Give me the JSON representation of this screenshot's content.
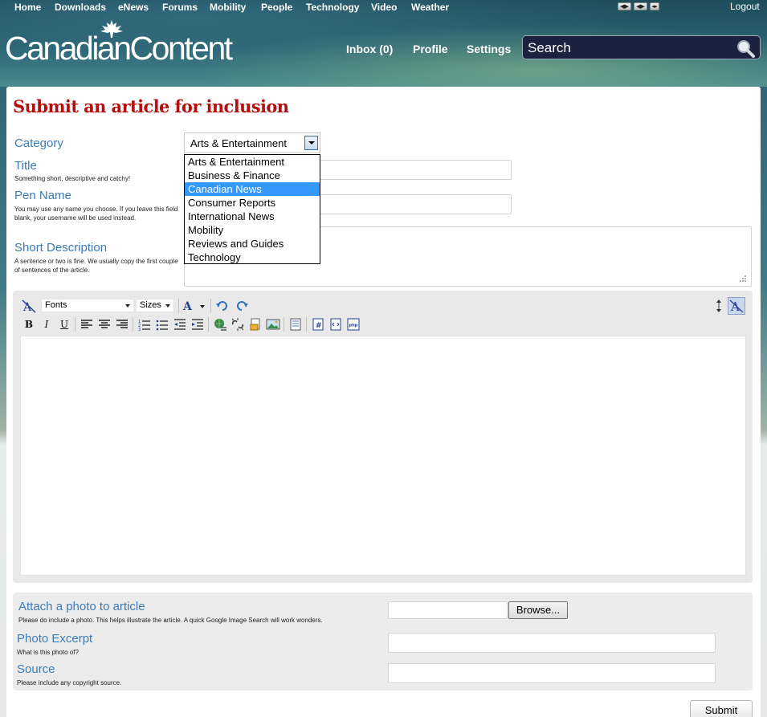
{
  "topnav": {
    "items": [
      "Home",
      "Downloads",
      "eNews",
      "Forums",
      "Mobility",
      "People",
      "Technology",
      "Video",
      "Weather"
    ],
    "logout": "Logout"
  },
  "logo": {
    "text": "CanadianContent"
  },
  "mainnav": {
    "inbox": "Inbox (0)",
    "profile": "Profile",
    "settings": "Settings"
  },
  "search": {
    "placeholder": "Search"
  },
  "page": {
    "title": "Submit an article for inclusion"
  },
  "form": {
    "category": {
      "label": "Category",
      "selected": "Arts & Entertainment",
      "options": [
        "Arts & Entertainment",
        "Business & Finance",
        "Canadian News",
        "Consumer Reports",
        "International News",
        "Mobility",
        "Reviews and Guides",
        "Technology"
      ],
      "highlighted": "Canadian News"
    },
    "title": {
      "label": "Title",
      "help": "Something short, descriptive and catchy!"
    },
    "pen_name": {
      "label": "Pen Name",
      "help": "You may use any name you choose. If you leave this field blank, your username will be used instead."
    },
    "short_description": {
      "label": "Short Description",
      "help": "A sentence or two is fine. We usually copy the first couple of sentences of the article."
    }
  },
  "editor": {
    "fonts_label": "Fonts",
    "sizes_label": "Sizes",
    "bold": "B",
    "italic": "I",
    "underline": "U"
  },
  "attach": {
    "photo": {
      "label": "Attach a photo to article",
      "help": "Please do include a photo. This helps illustrate the article. A quick Google Image Search will work wonders.",
      "browse": "Browse..."
    },
    "excerpt": {
      "label": "Photo Excerpt",
      "help": "What is this photo of?"
    },
    "source": {
      "label": "Source",
      "help": "Please include any copyright source."
    }
  },
  "submit": "Submit",
  "colors": {
    "title_red": "#b50e0e",
    "label_blue": "#3b7bb5",
    "dropdown_highlight": "#3399ff",
    "search_bg": "#1b2240"
  }
}
